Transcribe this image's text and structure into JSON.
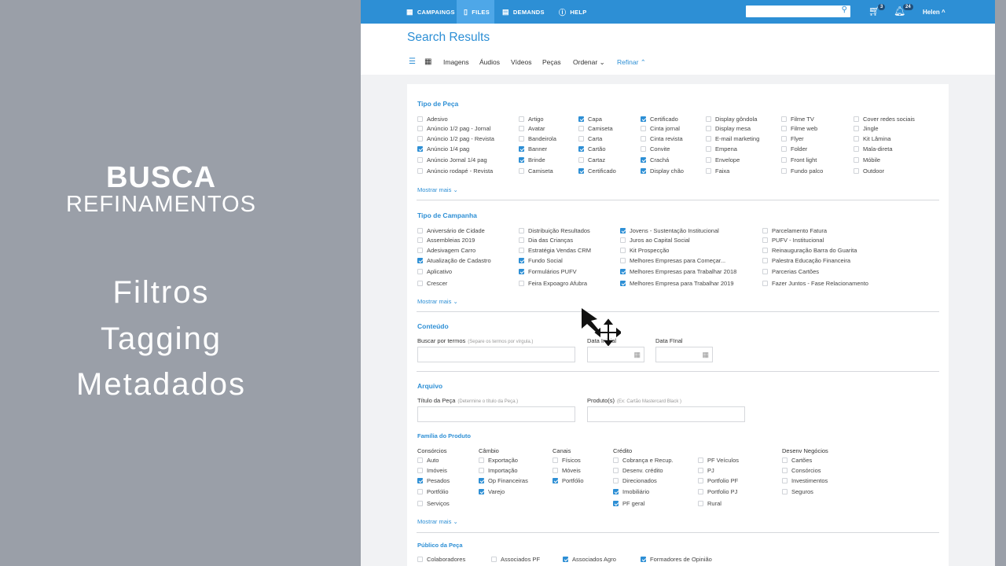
{
  "left": {
    "title": "BUSCA",
    "subtitle": "REFINAMENTOS",
    "items": [
      "Filtros",
      "Tagging",
      "Metadados"
    ]
  },
  "nav": {
    "items": [
      {
        "label": "CAMPAINGS",
        "icon": "calendar-icon"
      },
      {
        "label": "FILES",
        "icon": "file-icon"
      },
      {
        "label": "DEMANDS",
        "icon": "grid-icon"
      },
      {
        "label": "HELP",
        "icon": "help-icon"
      }
    ],
    "cart_count": "3",
    "notif_count": "24",
    "user": "Helen ^"
  },
  "page_title": "Search Results",
  "toolbar": {
    "images": "Imagens",
    "audios": "Áudios",
    "videos": "Vídeos",
    "pecas": "Peças",
    "ordenar": "Ordenar",
    "refinar": "Refinar"
  },
  "tipo_peca": {
    "title": "Tipo de Peça",
    "more": "Mostrar mais",
    "columns": [
      [
        [
          "Adesivo",
          false
        ],
        [
          "Anúncio 1/2 pag - Jornal",
          false
        ],
        [
          "Anúncio 1/2 pag - Revista",
          false
        ],
        [
          "Anúncio 1/4 pag",
          true
        ],
        [
          "Anúncio Jornal 1/4 pag",
          false
        ],
        [
          "Anúncio rodapé - Revista",
          false
        ]
      ],
      [
        [
          "Artigo",
          false
        ],
        [
          "Avatar",
          false
        ],
        [
          "Bandeirola",
          false
        ],
        [
          "Banner",
          true
        ],
        [
          "Brinde",
          true
        ],
        [
          "Camiseta",
          false
        ]
      ],
      [
        [
          "Capa",
          true
        ],
        [
          "Camiseta",
          false
        ],
        [
          "Carta",
          false
        ],
        [
          "Cartão",
          true
        ],
        [
          "Cartaz",
          false
        ],
        [
          "Certificado",
          true
        ]
      ],
      [
        [
          "Certificado",
          true
        ],
        [
          "Cinta jornal",
          false
        ],
        [
          "Cinta revista",
          false
        ],
        [
          "Convite",
          false
        ],
        [
          "Crachá",
          true
        ],
        [
          "Display chão",
          true
        ]
      ],
      [
        [
          "Display gôndola",
          false
        ],
        [
          "Display mesa",
          false
        ],
        [
          "E-mail marketing",
          false
        ],
        [
          "Empena",
          false
        ],
        [
          "Envelope",
          false
        ],
        [
          "Faixa",
          false
        ]
      ],
      [
        [
          "Filme TV",
          false
        ],
        [
          "Filme web",
          false
        ],
        [
          "Flyer",
          false
        ],
        [
          "Folder",
          false
        ],
        [
          "Front light",
          false
        ],
        [
          "Fundo palco",
          false
        ]
      ],
      [
        [
          "Cover redes sociais",
          false
        ],
        [
          "Jingle",
          false
        ],
        [
          "Kit Lâmina",
          false
        ],
        [
          "Mala-direta",
          false
        ],
        [
          "Móbile",
          false
        ],
        [
          "Outdoor",
          false
        ]
      ]
    ]
  },
  "tipo_campanha": {
    "title": "Tipo de Campanha",
    "more": "Mostrar mais",
    "columns": [
      [
        [
          "Aniversário de Cidade",
          false
        ],
        [
          "Assembleias 2019",
          false
        ],
        [
          "Adesivagem Carro",
          false
        ],
        [
          "Atualização de Cadastro",
          true
        ],
        [
          "Aplicativo",
          false
        ],
        [
          "Crescer",
          false
        ]
      ],
      [
        [
          "Distribuição Resultados",
          false
        ],
        [
          "Dia das Crianças",
          false
        ],
        [
          "Estratégia Vendas CRM",
          false
        ],
        [
          "Fundo Social",
          true
        ],
        [
          "Formulários PUFV",
          true
        ],
        [
          "Feira Expoagro Afubra",
          false
        ]
      ],
      [
        [
          "Jovens - Sustentação Institucional",
          true
        ],
        [
          "Juros ao Capital Social",
          false
        ],
        [
          "Kit Prospecção",
          false
        ],
        [
          "Melhores Empresas para Começar...",
          false
        ],
        [
          "Melhores Empresas para Trabalhar 2018",
          true
        ],
        [
          "Melhores Empresa para Trabalhar 2019",
          true
        ]
      ],
      [
        [
          "Parcelamento Fatura",
          false
        ],
        [
          "PUFV - Institucional",
          false
        ],
        [
          "Reinauguração Barra do Guarita",
          false
        ],
        [
          "Palestra Educação Financeira",
          false
        ],
        [
          "Parcerias Cartões",
          false
        ],
        [
          "Fazer Juntos - Fase Relacionamento",
          false
        ]
      ]
    ]
  },
  "conteudo": {
    "title": "Conteúdo",
    "buscar_label": "Buscar por termos",
    "buscar_hint": "(Separe os termos por vírgula.)",
    "data_inicial": "Data Inicial",
    "data_final": "Data FInal"
  },
  "arquivo": {
    "title": "Arquivo",
    "titulo_label": "Título da Peça",
    "titulo_hint": "(Determine o título da Peça.)",
    "produto_label": "Produto(s)",
    "produto_hint": "(Ex: Cartão Mastercard Black )"
  },
  "familia": {
    "title": "Família do Produto",
    "more": "Mostrar mais",
    "groups": [
      {
        "name": "Consórcios",
        "items": [
          [
            "Auto",
            false
          ],
          [
            "Imóveis",
            false
          ],
          [
            "Pesados",
            true
          ],
          [
            "Portfólio",
            false
          ],
          [
            "Serviços",
            false
          ]
        ]
      },
      {
        "name": "Câmbio",
        "items": [
          [
            "Exportação",
            false
          ],
          [
            "Importação",
            false
          ],
          [
            "Op Financeiras",
            true
          ],
          [
            "Varejo",
            true
          ]
        ]
      },
      {
        "name": "Canais",
        "items": [
          [
            "Físicos",
            false
          ],
          [
            "Móveis",
            false
          ],
          [
            "Portfólio",
            true
          ]
        ]
      },
      {
        "name": "Crédito",
        "items": [
          [
            "Cobrança e Recup.",
            false
          ],
          [
            "Desenv. crédito",
            false
          ],
          [
            "Direcionados",
            false
          ],
          [
            "Imobiliário",
            true
          ],
          [
            "PF geral",
            true
          ]
        ]
      },
      {
        "name": "",
        "items": [
          [
            "PF Veículos",
            false
          ],
          [
            "PJ",
            false
          ],
          [
            "Portfolio PF",
            false
          ],
          [
            "Portfolio PJ",
            false
          ],
          [
            "Rural",
            false
          ]
        ]
      },
      {
        "name": "Desenv Negócios",
        "items": [
          [
            "Cartões",
            false
          ],
          [
            "Consórcios",
            false
          ],
          [
            "Investimentos",
            false
          ],
          [
            "Seguros",
            false
          ]
        ]
      }
    ]
  },
  "publico": {
    "title": "Público da Peça",
    "items": [
      [
        "Colaboradores",
        false
      ],
      [
        "Associados PF",
        false
      ],
      [
        "Associados Agro",
        true
      ],
      [
        "Formadores de Opinião",
        true
      ]
    ]
  }
}
